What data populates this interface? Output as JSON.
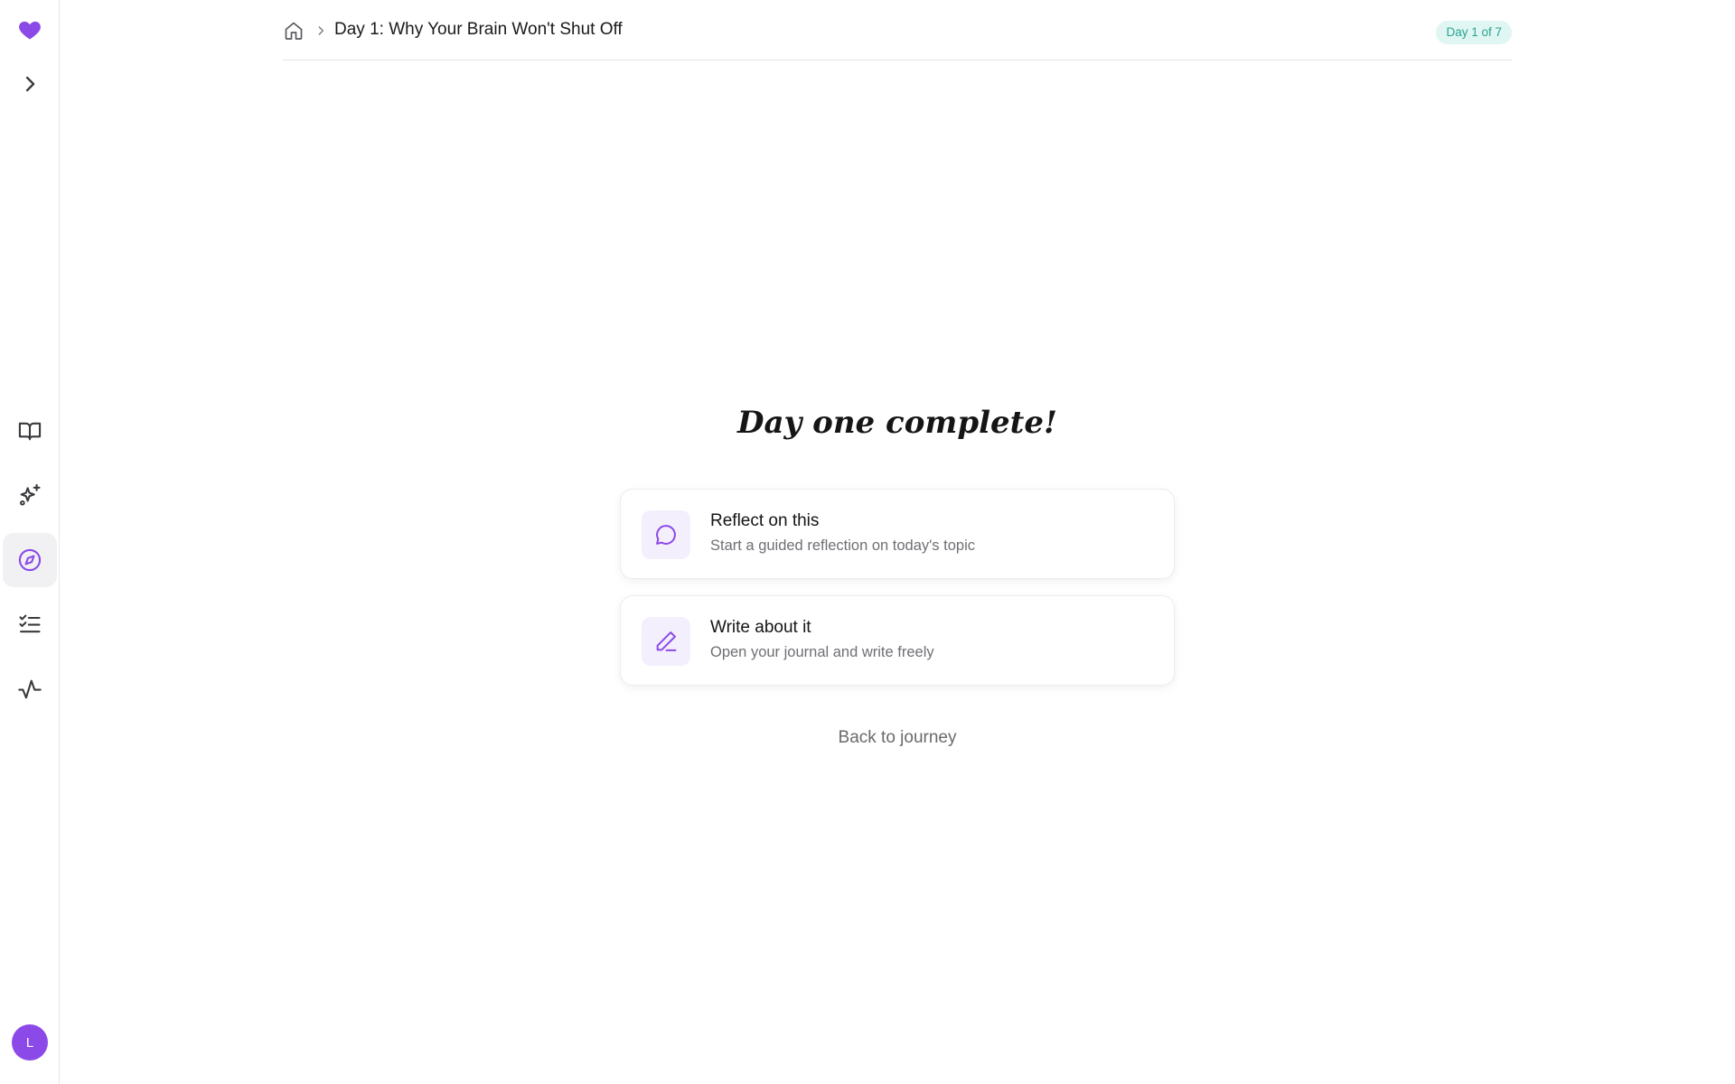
{
  "sidebar": {
    "logo_icon": "heart-icon",
    "expand_icon": "chevron-right-icon",
    "nav_items": [
      {
        "name": "library",
        "icon": "book-open-icon"
      },
      {
        "name": "insights",
        "icon": "sparkles-icon"
      },
      {
        "name": "journeys",
        "icon": "compass-icon",
        "active": true
      },
      {
        "name": "tasks",
        "icon": "list-checks-icon"
      },
      {
        "name": "activity",
        "icon": "activity-icon"
      }
    ],
    "avatar_initial": "L"
  },
  "header": {
    "home_icon": "home-icon",
    "breadcrumb_title": "Day 1: Why Your Brain Won't Shut Off",
    "day_badge": "Day 1 of 7"
  },
  "main": {
    "headline": "Day one complete!",
    "cards": [
      {
        "title": "Reflect on this",
        "subtitle": "Start a guided reflection on today's topic",
        "icon": "chat-bubble-icon"
      },
      {
        "title": "Write about it",
        "subtitle": "Open your journal and write freely",
        "icon": "pencil-icon"
      }
    ],
    "back_link": "Back to journey"
  },
  "colors": {
    "accent": "#8b4ae8",
    "badge_bg": "#dff6f2",
    "badge_text": "#2aa392"
  }
}
